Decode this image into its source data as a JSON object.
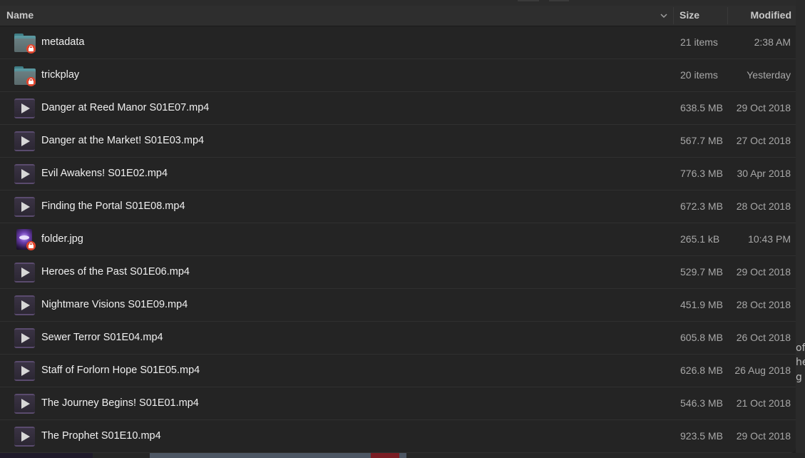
{
  "header": {
    "name": "Name",
    "size": "Size",
    "modified": "Modified"
  },
  "files": [
    {
      "name": "metadata",
      "size": "21 items",
      "modified": "2:38 AM",
      "type": "folder",
      "locked": true
    },
    {
      "name": "trickplay",
      "size": "20 items",
      "modified": "Yesterday",
      "type": "folder",
      "locked": true
    },
    {
      "name": "Danger at Reed Manor S01E07.mp4",
      "size": "638.5 MB",
      "modified": "29 Oct 2018",
      "type": "video"
    },
    {
      "name": "Danger at the Market! S01E03.mp4",
      "size": "567.7 MB",
      "modified": "27 Oct 2018",
      "type": "video"
    },
    {
      "name": "Evil Awakens! S01E02.mp4",
      "size": "776.3 MB",
      "modified": "30 Apr 2018",
      "type": "video"
    },
    {
      "name": "Finding the Portal S01E08.mp4",
      "size": "672.3 MB",
      "modified": "28 Oct 2018",
      "type": "video"
    },
    {
      "name": "folder.jpg",
      "size": "265.1 kB",
      "modified": "10:43 PM",
      "type": "image",
      "locked": true
    },
    {
      "name": "Heroes of the Past S01E06.mp4",
      "size": "529.7 MB",
      "modified": "29 Oct 2018",
      "type": "video"
    },
    {
      "name": "Nightmare Visions S01E09.mp4",
      "size": "451.9 MB",
      "modified": "28 Oct 2018",
      "type": "video"
    },
    {
      "name": "Sewer Terror S01E04.mp4",
      "size": "605.8 MB",
      "modified": "26 Oct 2018",
      "type": "video"
    },
    {
      "name": "Staff of Forlorn Hope S01E05.mp4",
      "size": "626.8 MB",
      "modified": "26 Aug 2018",
      "type": "video"
    },
    {
      "name": "The Journey Begins! S01E01.mp4",
      "size": "546.3 MB",
      "modified": "21 Oct 2018",
      "type": "video"
    },
    {
      "name": "The Prophet S01E10.mp4",
      "size": "923.5 MB",
      "modified": "29 Oct 2018",
      "type": "video"
    }
  ],
  "background_fragments": [
    "of",
    "he",
    "g"
  ]
}
